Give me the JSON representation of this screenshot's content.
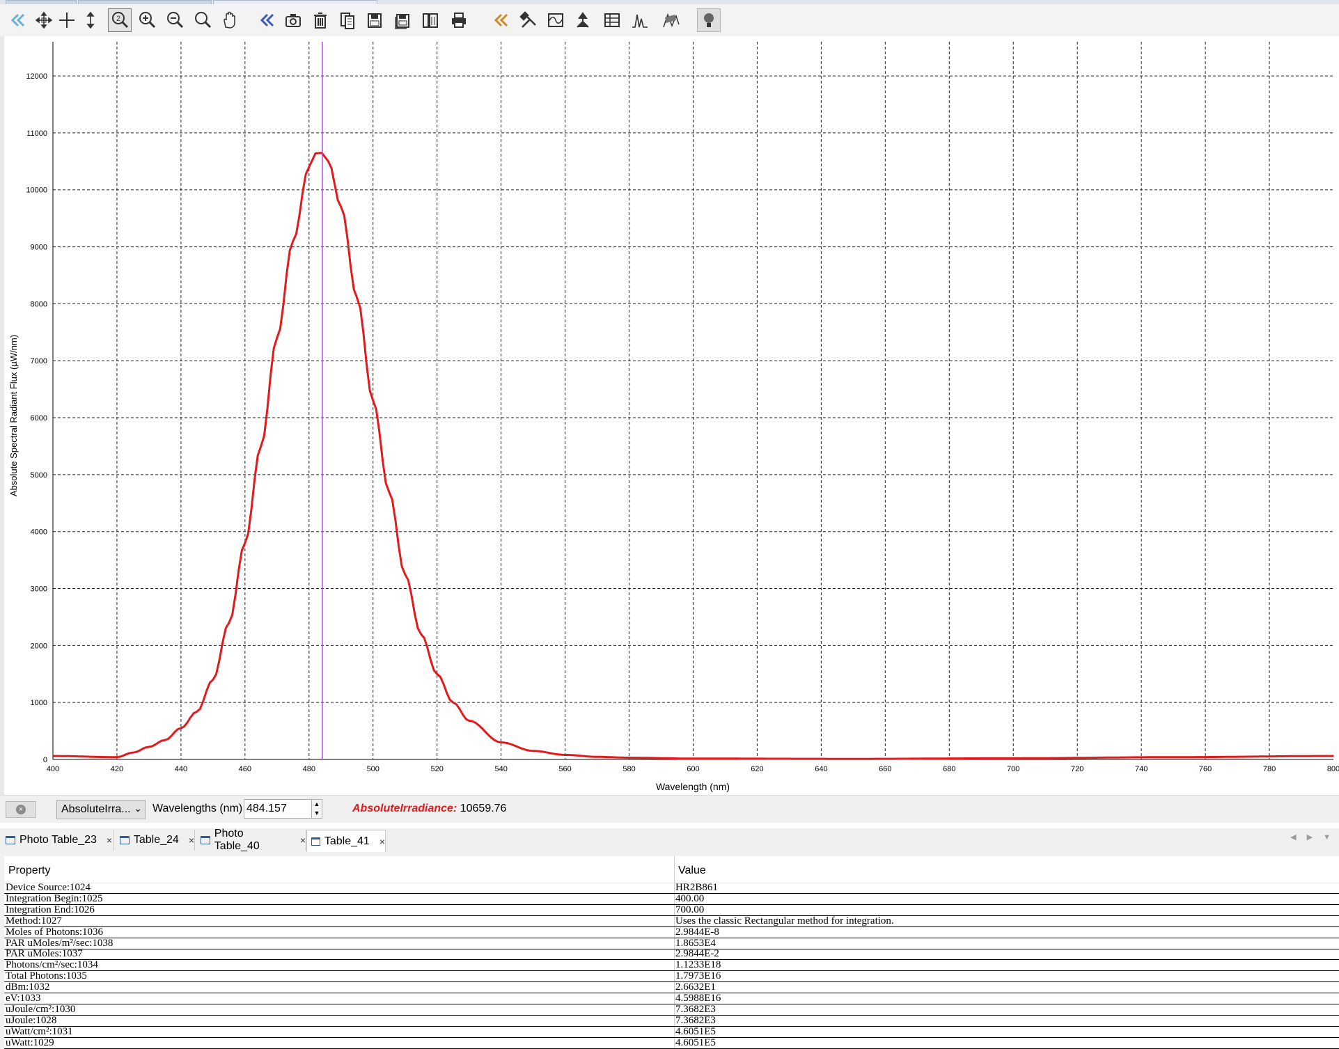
{
  "toolbar": {
    "buttons": [
      {
        "name": "graph-back-button",
        "icon": "double-chevron-left-icon"
      },
      {
        "name": "move-cross-button",
        "icon": "move-arrows-icon"
      },
      {
        "name": "crosshair-button",
        "icon": "crosshair-icon"
      },
      {
        "name": "vertical-arrow-button",
        "icon": "vertical-arrow-icon"
      },
      {
        "name": "zoom-auto-button",
        "icon": "zoom-2-icon",
        "active": true
      },
      {
        "name": "zoom-in-button",
        "icon": "zoom-in-icon"
      },
      {
        "name": "zoom-out-button",
        "icon": "zoom-out-icon"
      },
      {
        "name": "zoom-button",
        "icon": "magnifier-icon"
      },
      {
        "name": "pan-button",
        "icon": "hand-icon"
      },
      {
        "name": "previous-button",
        "icon": "double-chevron-left-blue-icon"
      },
      {
        "name": "snapshot-button",
        "icon": "camera-icon"
      },
      {
        "name": "delete-button",
        "icon": "trash-icon"
      },
      {
        "name": "overlay-button",
        "icon": "overlay-icon"
      },
      {
        "name": "save-button",
        "icon": "save-icon"
      },
      {
        "name": "save-all-button",
        "icon": "save-stack-icon"
      },
      {
        "name": "export-button",
        "icon": "export-icon"
      },
      {
        "name": "print-button",
        "icon": "printer-icon"
      },
      {
        "name": "collapse-button",
        "icon": "double-chevron-left-orange-icon"
      },
      {
        "name": "tools-button",
        "icon": "tools-icon"
      },
      {
        "name": "waveform-button",
        "icon": "waveform-icon"
      },
      {
        "name": "peak-button",
        "icon": "peak-arrow-icon"
      },
      {
        "name": "table-button",
        "icon": "table-icon"
      },
      {
        "name": "peaks-button",
        "icon": "peaks-icon"
      },
      {
        "name": "flags-button",
        "icon": "flags-icon"
      },
      {
        "name": "lamp-button",
        "icon": "lightbulb-icon"
      }
    ]
  },
  "chart_data": {
    "type": "line",
    "xlabel": "Wavelength (nm)",
    "ylabel": "Absolute Spectral Radiant Flux (µW/nm)",
    "xlim": [
      400,
      800
    ],
    "ylim": [
      0,
      12600
    ],
    "xticks": [
      400,
      420,
      440,
      460,
      480,
      500,
      520,
      540,
      560,
      580,
      600,
      620,
      640,
      660,
      680,
      700,
      720,
      740,
      760,
      780,
      800
    ],
    "yticks": [
      0,
      1000,
      2000,
      3000,
      4000,
      5000,
      6000,
      7000,
      8000,
      9000,
      10000,
      11000,
      12000
    ],
    "grid": true,
    "cursor_x": 484.157,
    "series": [
      {
        "color": "#e31a1c",
        "x": [
          400,
          420,
          425,
          430,
          435,
          440,
          445,
          450,
          455,
          460,
          465,
          470,
          475,
          480,
          482,
          484,
          486,
          490,
          495,
          500,
          505,
          510,
          515,
          520,
          525,
          530,
          540,
          550,
          560,
          570,
          580,
          600,
          650,
          700,
          750,
          800
        ],
        "y": [
          60,
          40,
          120,
          220,
          340,
          550,
          840,
          1400,
          2400,
          3800,
          5500,
          7400,
          9100,
          10400,
          10640,
          10650,
          10500,
          9700,
          8100,
          6300,
          4700,
          3250,
          2200,
          1500,
          1000,
          680,
          300,
          150,
          80,
          45,
          30,
          15,
          10,
          20,
          40,
          60
        ]
      }
    ]
  },
  "controls": {
    "series_select": "AbsoluteIrra...",
    "wavelength_label": "Wavelengths (nm)",
    "wavelength_value": "484.157",
    "readout_key": "AbsoluteIrradiance:",
    "readout_value": "10659.76"
  },
  "tabs": [
    {
      "label": "Photo Table_23",
      "active": false
    },
    {
      "label": "Table_24",
      "active": false
    },
    {
      "label": "Photo Table_40",
      "active": false
    },
    {
      "label": "Table_41",
      "active": true
    }
  ],
  "table": {
    "headers": [
      "Property",
      "Value"
    ],
    "rows": [
      [
        "Device Source:1024",
        "HR2B861"
      ],
      [
        "Integration Begin:1025",
        "400.00"
      ],
      [
        "Integration End:1026",
        "700.00"
      ],
      [
        "Method:1027",
        "Uses the classic Rectangular method for integration."
      ],
      [
        "Moles of Photons:1036",
        "2.9844E-8"
      ],
      [
        "PAR uMoles/m²/sec:1038",
        "1.8653E4"
      ],
      [
        "PAR uMoles:1037",
        "2.9844E-2"
      ],
      [
        "Photons/cm²/sec:1034",
        "1.1233E18"
      ],
      [
        "Total Photons:1035",
        "1.7973E16"
      ],
      [
        "dBm:1032",
        "2.6632E1"
      ],
      [
        "eV:1033",
        "4.5988E16"
      ],
      [
        "uJoule/cm²:1030",
        "7.3682E3"
      ],
      [
        "uJoule:1028",
        "7.3682E3"
      ],
      [
        "uWatt/cm²:1031",
        "4.6051E5"
      ],
      [
        "uWatt:1029",
        "4.6051E5"
      ]
    ]
  }
}
